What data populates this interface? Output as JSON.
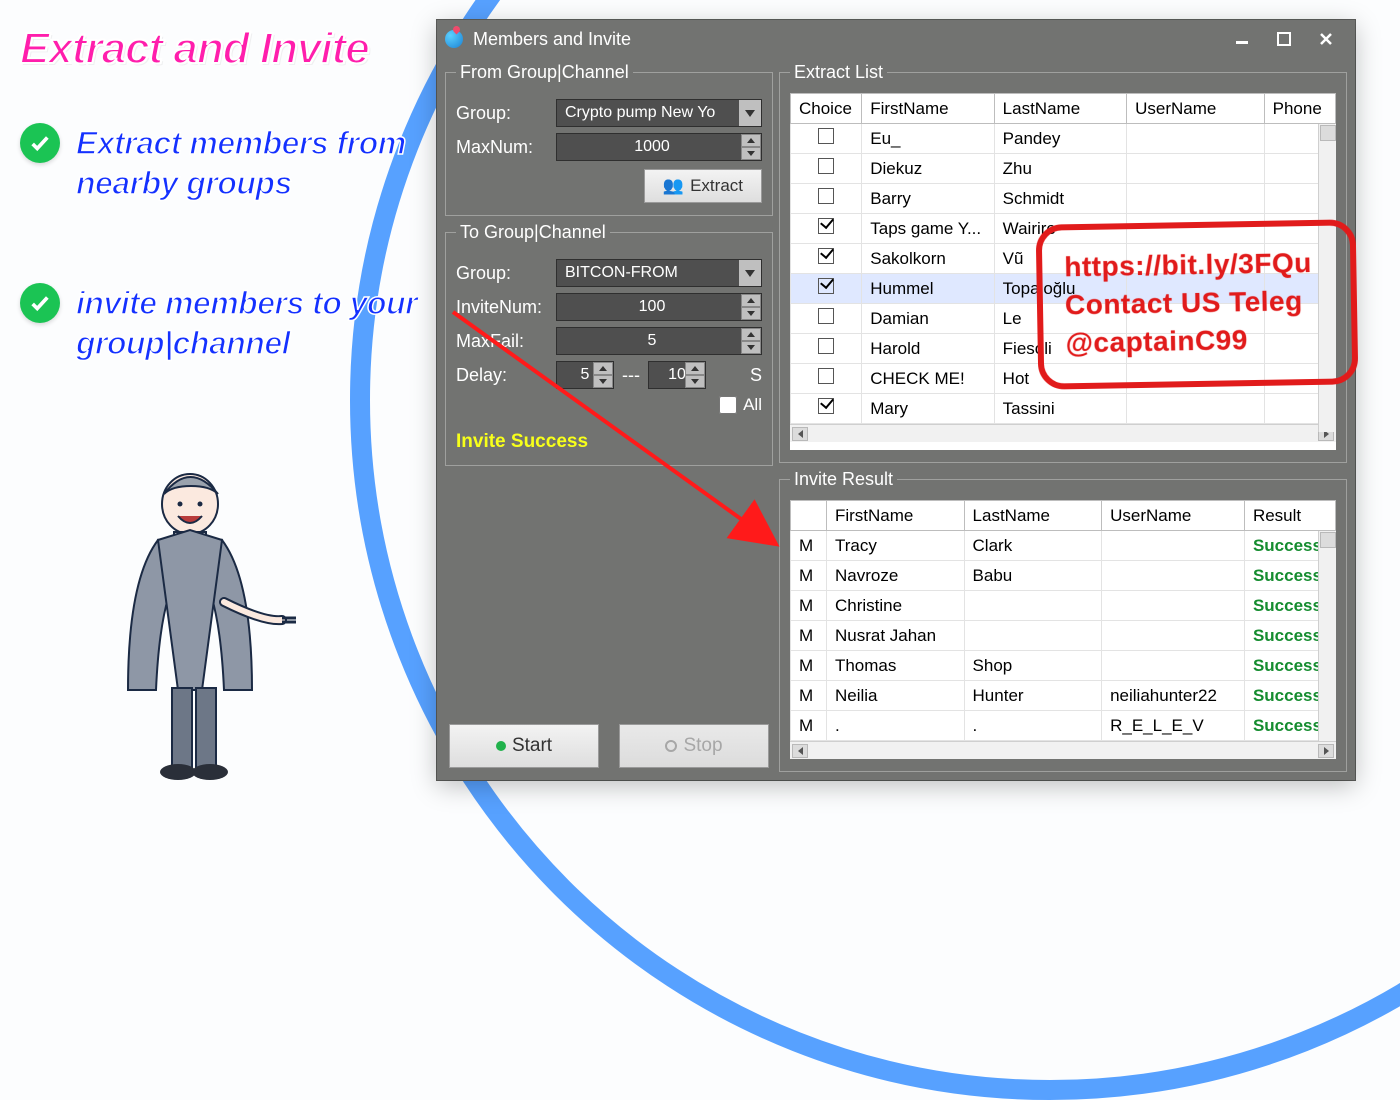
{
  "promo": {
    "headline": "Extract and Invite",
    "bullet1": "Extract members from nearby groups",
    "bullet2": "invite members to your group|channel"
  },
  "window": {
    "title": "Members and Invite"
  },
  "from": {
    "legend": "From Group|Channel",
    "group_label": "Group:",
    "group_value": "Crypto pump New Yo",
    "maxnum_label": "MaxNum:",
    "maxnum_value": "1000",
    "extract_btn": "Extract"
  },
  "to": {
    "legend": "To Group|Channel",
    "group_label": "Group:",
    "group_value": "BITCON-FROM",
    "invitenum_label": "InviteNum:",
    "invitenum_value": "100",
    "maxfail_label": "MaxFail:",
    "maxfail_value": "5",
    "delay_label": "Delay:",
    "delay_min": "5",
    "delay_max": "10",
    "delay_unit": "S",
    "all_label": "All",
    "status": "Invite Success"
  },
  "bottom": {
    "start": "Start",
    "stop": "Stop"
  },
  "extract_list": {
    "legend": "Extract List",
    "cols": {
      "choice": "Choice",
      "first": "FirstName",
      "last": "LastName",
      "user": "UserName",
      "phone": "Phone"
    },
    "rows": [
      {
        "checked": false,
        "first": "Eu_",
        "last": "Pandey"
      },
      {
        "checked": false,
        "first": "Diekuz",
        "last": "Zhu"
      },
      {
        "checked": false,
        "first": "Barry",
        "last": "Schmidt"
      },
      {
        "checked": true,
        "first": "Taps game Y...",
        "last": "Wairire"
      },
      {
        "checked": true,
        "first": "Sakolkorn",
        "last": "Vũ"
      },
      {
        "checked": true,
        "first": "Hummel",
        "last": "Topaloğlu",
        "selected": true
      },
      {
        "checked": false,
        "first": "Damian",
        "last": "Le"
      },
      {
        "checked": false,
        "first": "Harold",
        "last": "Fiesoli"
      },
      {
        "checked": false,
        "first": "CHECK ME!",
        "last": "Hot"
      },
      {
        "checked": true,
        "first": "Mary",
        "last": "Tassini"
      }
    ]
  },
  "invite_result": {
    "legend": "Invite Result",
    "cols": {
      "m": "",
      "first": "FirstName",
      "last": "LastName",
      "user": "UserName",
      "result": "Result"
    },
    "rows": [
      {
        "m": "M",
        "first": "Tracy",
        "last": "Clark",
        "user": "",
        "result": "Success"
      },
      {
        "m": "M",
        "first": "Navroze",
        "last": "Babu",
        "user": "",
        "result": "Success"
      },
      {
        "m": "M",
        "first": "Christine",
        "last": "",
        "user": "",
        "result": "Success"
      },
      {
        "m": "M",
        "first": "Nusrat Jahan",
        "last": "",
        "user": "",
        "result": "Success"
      },
      {
        "m": "M",
        "first": "Thomas",
        "last": "Shop",
        "user": "",
        "result": "Success"
      },
      {
        "m": "M",
        "first": "Neilia",
        "last": "Hunter",
        "user": "neiliahunter22",
        "result": "Success"
      },
      {
        "m": "M",
        "first": ".",
        "last": ".",
        "user": "R_E_L_E_V",
        "result": "Success"
      }
    ]
  },
  "stamp": {
    "line1": "https://bit.ly/3FQu",
    "line2": "Contact US  Teleg",
    "line3": "@captainC99"
  }
}
